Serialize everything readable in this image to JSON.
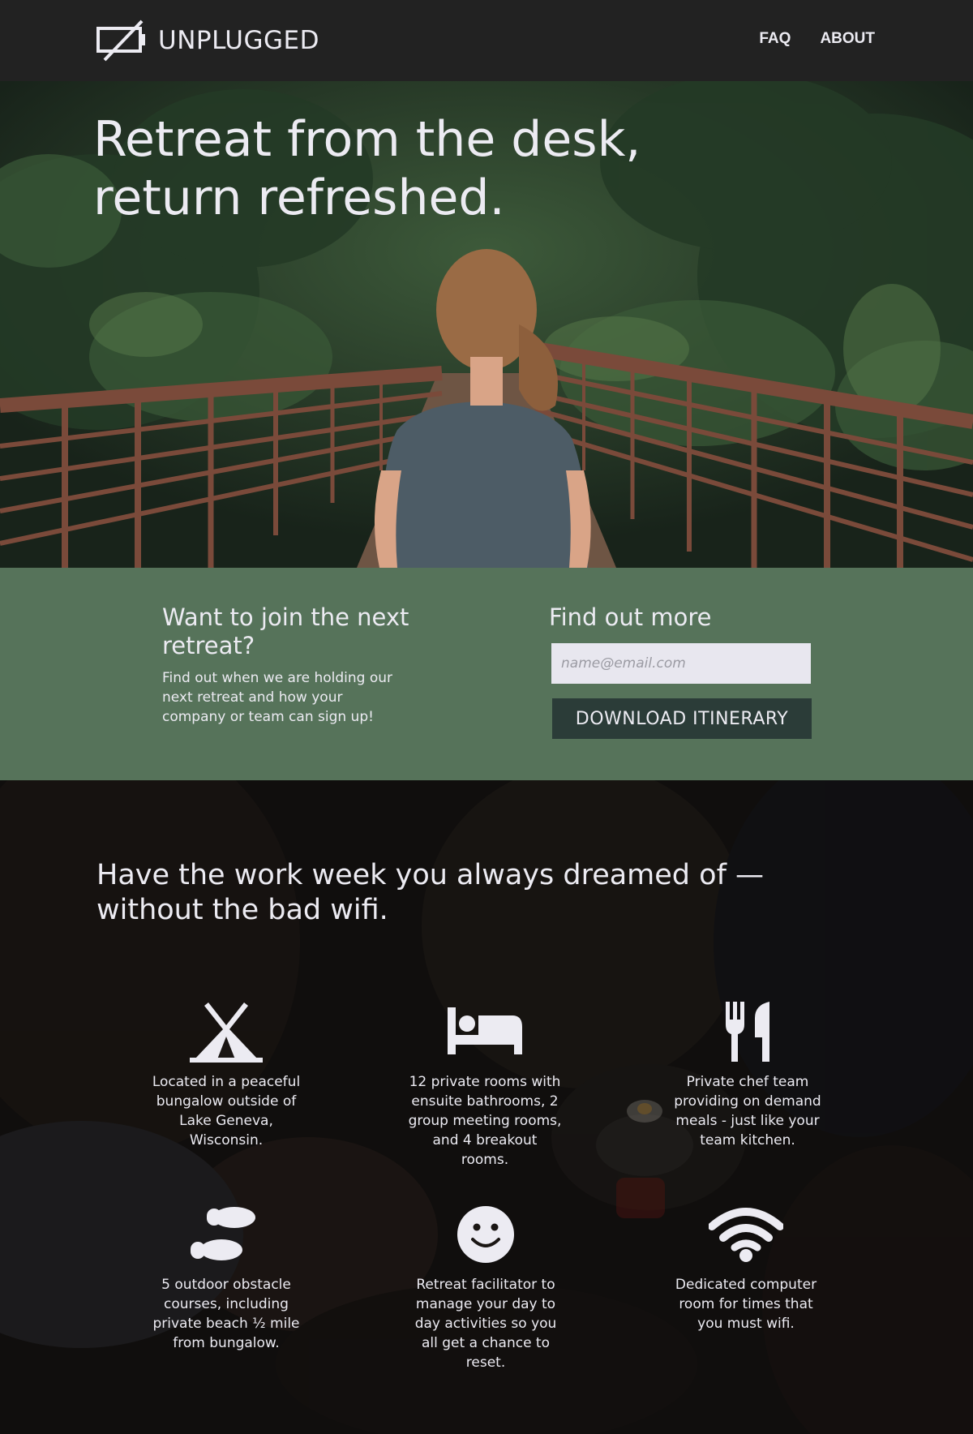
{
  "header": {
    "brand": "UNPLUGGED",
    "nav": [
      {
        "label": "FAQ"
      },
      {
        "label": "ABOUT"
      }
    ]
  },
  "hero": {
    "title_line1": "Retreat from the desk,",
    "title_line2": "return refreshed."
  },
  "signup": {
    "left_heading": "Want to join the next retreat?",
    "left_text": "Find out when we are holding our next retreat and how your company or team can sign up!",
    "right_heading": "Find out more",
    "email_placeholder": "name@email.com",
    "button_label": "DOWNLOAD ITINERARY"
  },
  "features": {
    "title": "Have the work week you always dreamed of — without the bad wifi.",
    "items": [
      {
        "icon": "tent-icon",
        "text": "Located in a peaceful bungalow outside of Lake Geneva, Wisconsin."
      },
      {
        "icon": "bed-icon",
        "text": "12 private rooms with ensuite bathrooms, 2 group meeting rooms, and 4 breakout rooms."
      },
      {
        "icon": "utensils-icon",
        "text": "Private chef team providing on demand meals - just like your team kitchen."
      },
      {
        "icon": "footprints-icon",
        "text": "5 outdoor obstacle courses, including private beach ½ mile from bungalow."
      },
      {
        "icon": "smile-icon",
        "text": "Retreat facilitator to manage your day to day activities so you all get a chance to reset."
      },
      {
        "icon": "wifi-icon",
        "text": "Dedicated computer room for times that you must wifi."
      }
    ]
  },
  "colors": {
    "header_bg": "#222222",
    "signup_bg": "#56735a",
    "button_bg": "#2b3c38",
    "text_light": "#ecebf2"
  }
}
